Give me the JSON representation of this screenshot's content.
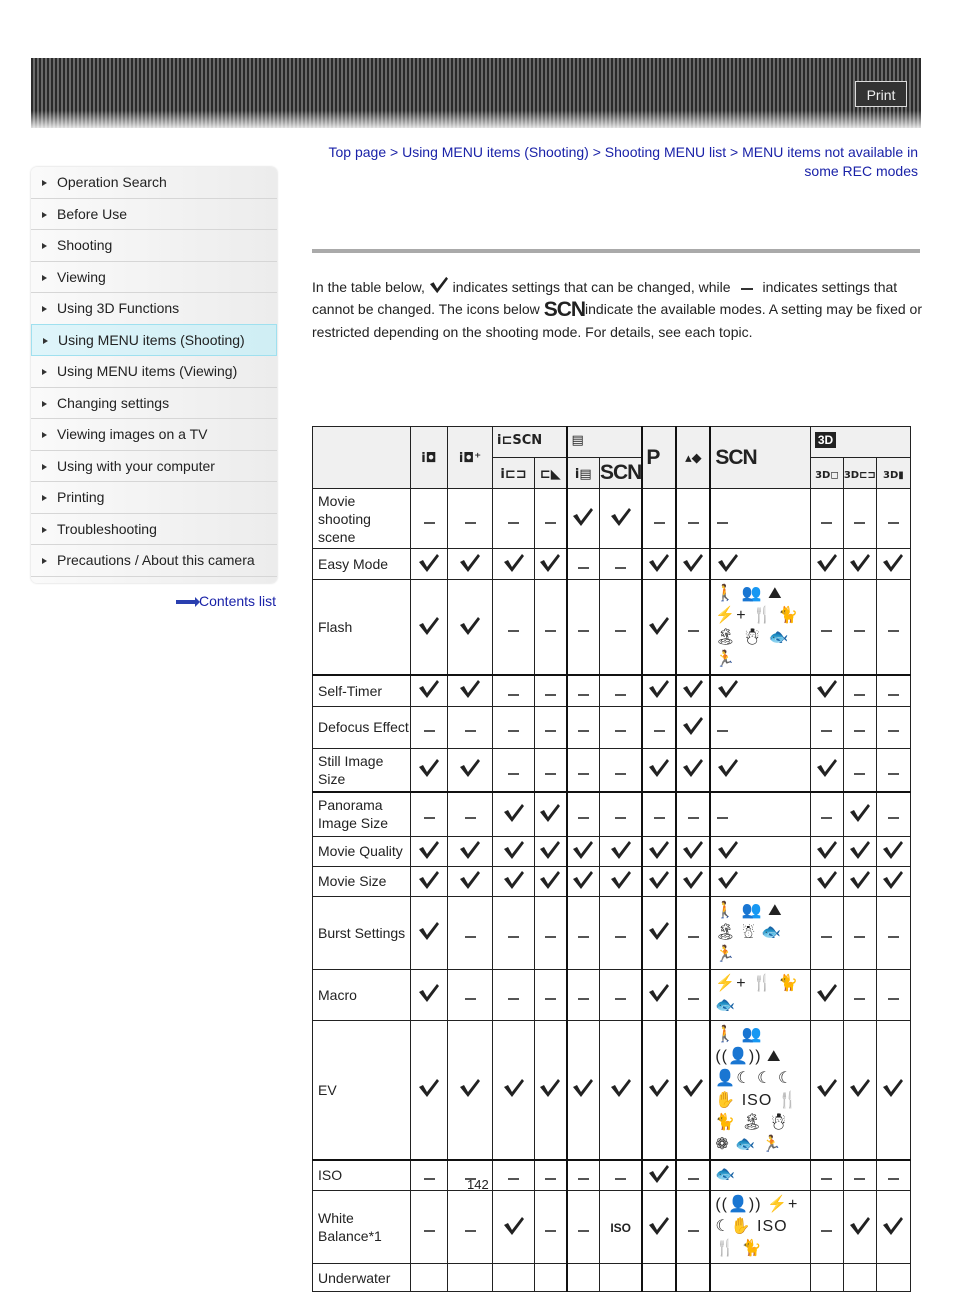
{
  "header": {
    "print_label": "Print"
  },
  "sidebar": {
    "items": [
      {
        "label": "Operation Search",
        "active": false
      },
      {
        "label": "Before Use",
        "active": false
      },
      {
        "label": "Shooting",
        "active": false
      },
      {
        "label": "Viewing",
        "active": false
      },
      {
        "label": "Using 3D Functions",
        "active": false
      },
      {
        "label": "Using MENU items (Shooting)",
        "active": true
      },
      {
        "label": "Using MENU items (Viewing)",
        "active": false
      },
      {
        "label": "Changing settings",
        "active": false
      },
      {
        "label": "Viewing images on a TV",
        "active": false
      },
      {
        "label": "Using with your computer",
        "active": false
      },
      {
        "label": "Printing",
        "active": false
      },
      {
        "label": "Troubleshooting",
        "active": false
      },
      {
        "label": "Precautions / About this camera",
        "active": false
      }
    ],
    "contents_link": "Contents list"
  },
  "breadcrumb": {
    "items": [
      "Top page",
      "Using MENU items (Shooting)",
      "Shooting MENU list",
      "MENU items not available in some REC modes"
    ],
    "separator": " > "
  },
  "intro": {
    "part1": "In the table below,",
    "part2": "indicates settings that can be changed, while",
    "part3": "indicates settings that cannot be changed. The icons below",
    "scn": "SCN",
    "part4": "indicate the available modes. A setting may be fixed or restricted depending on the shooting mode. For details, see each topic."
  },
  "table": {
    "header_top": [
      {
        "id": "iauto",
        "label": "i◘",
        "icon": "intelligent-auto-icon"
      },
      {
        "id": "superior",
        "label": "i◘⁺",
        "icon": "superior-auto-icon"
      },
      {
        "id": "sweep_group",
        "label": "i⊏SCN",
        "icon": "sweep-panorama-group-icon"
      },
      {
        "id": "movie_group",
        "label": "▤",
        "icon": "movie-mode-group-icon"
      },
      {
        "id": "p",
        "label": "P",
        "icon": "program-auto-icon"
      },
      {
        "id": "bgdefocus",
        "label": "▴◆",
        "icon": "background-defocus-icon"
      },
      {
        "id": "scn",
        "label": "SCN",
        "icon": "scene-selection-icon"
      },
      {
        "id": "3d_group",
        "label": "3D",
        "icon": "3d-group-icon"
      }
    ],
    "header_sub": [
      {
        "group": "sweep_group",
        "label": "i⊏⊐",
        "icon": "intelligent-sweep-panorama-icon"
      },
      {
        "group": "sweep_group",
        "label": "⊏◣",
        "icon": "sweep-panorama-scn-icon"
      },
      {
        "group": "movie_group",
        "label": "i▤",
        "icon": "intelligent-movie-icon"
      },
      {
        "group": "movie_group",
        "label": "SCN",
        "icon": "movie-scn-icon"
      },
      {
        "group": "3d_group",
        "label": "3D◻",
        "icon": "3d-still-icon"
      },
      {
        "group": "3d_group",
        "label": "3D⊏⊐",
        "icon": "3d-sweep-icon"
      },
      {
        "group": "3d_group",
        "label": "3D▮",
        "icon": "3d-multi-angle-icon"
      }
    ],
    "legend": {
      "check": "check",
      "dash": "dash"
    },
    "rows": [
      {
        "label": "Movie shooting scene",
        "cells": [
          "dash",
          "dash",
          "dash",
          "dash",
          "check",
          "check",
          "dash",
          "dash",
          "dash",
          "dash",
          "dash",
          "dash"
        ],
        "thick_top": false
      },
      {
        "label": "Easy Mode",
        "cells": [
          "check",
          "check",
          "check",
          "check",
          "dash",
          "dash",
          "check",
          "check",
          "check",
          "check",
          "check",
          "check"
        ],
        "thick_top": false
      },
      {
        "label": "Flash",
        "cells": [
          "check",
          "check",
          "dash",
          "dash",
          "dash",
          "dash",
          "check",
          "dash",
          {
            "icons": "🚶 👥 ⛰ ⚡+ 🍴 🐈 🏝 ☃ 🐟 🏃"
          },
          "dash",
          "dash",
          "dash"
        ],
        "thick_top": false
      },
      {
        "label": "Self-Timer",
        "cells": [
          "check",
          "check",
          "dash",
          "dash",
          "dash",
          "dash",
          "check",
          "check",
          "check",
          "check",
          "dash",
          "dash"
        ],
        "thick_top": true
      },
      {
        "label": "Defocus Effect",
        "cells": [
          "dash",
          "dash",
          "dash",
          "dash",
          "dash",
          "dash",
          "dash",
          "check",
          "dash",
          "dash",
          "dash",
          "dash"
        ],
        "thick_top": false
      },
      {
        "label": "Still Image Size",
        "cells": [
          "check",
          "check",
          "dash",
          "dash",
          "dash",
          "dash",
          "check",
          "check",
          "check",
          "check",
          "dash",
          "dash"
        ],
        "thick_top": false
      },
      {
        "label": "Panorama Image Size",
        "cells": [
          "dash",
          "dash",
          "check",
          "check",
          "dash",
          "dash",
          "dash",
          "dash",
          "dash",
          "dash",
          "check",
          "dash"
        ],
        "thick_top": true
      },
      {
        "label": "Movie Quality",
        "cells": [
          "check",
          "check",
          "check",
          "check",
          "check",
          "check",
          "check",
          "check",
          "check",
          "check",
          "check",
          "check"
        ],
        "thick_top": false
      },
      {
        "label": "Movie Size",
        "cells": [
          "check",
          "check",
          "check",
          "check",
          "check",
          "check",
          "check",
          "check",
          "check",
          "check",
          "check",
          "check"
        ],
        "thick_top": false
      },
      {
        "label": "Burst Settings",
        "cells": [
          "check",
          "dash",
          "dash",
          "dash",
          "dash",
          "dash",
          "check",
          "dash",
          {
            "icons": "🚶 👥 ⛰ 🏝 ☃ 🐟 🏃"
          },
          "dash",
          "dash",
          "dash"
        ],
        "thick_top": false
      },
      {
        "label": "Macro",
        "cells": [
          "check",
          "dash",
          "dash",
          "dash",
          "dash",
          "dash",
          "check",
          "dash",
          {
            "icons": "⚡+ 🍴 🐈 🐟"
          },
          "check",
          "dash",
          "dash"
        ],
        "thick_top": false
      },
      {
        "label": "EV",
        "cells": [
          "check",
          "check",
          "check",
          "check",
          "check",
          "check",
          "check",
          "check",
          {
            "icons": "🚶 👥 ((👤)) ⛰ 👤☾ ☾ ☾✋ ISO 🍴 🐈 🏝 ☃ ❁ 🐟 🏃"
          },
          "check",
          "check",
          "check"
        ],
        "thick_top": false
      },
      {
        "label": "ISO",
        "cells": [
          "dash",
          "dash",
          "dash",
          "dash",
          "dash",
          "dash",
          "check",
          "dash",
          {
            "icons": "🐟"
          },
          "dash",
          "dash",
          "dash"
        ],
        "thick_top": true
      },
      {
        "label": "White Balance*1",
        "cells": [
          "dash",
          "dash",
          "check",
          "dash",
          "dash",
          {
            "icons": "ISO"
          },
          "check",
          "dash",
          {
            "icons": "((👤)) ⚡+ ☾✋ ISO 🍴 🐈"
          },
          "dash",
          "check",
          "check"
        ],
        "thick_top": false
      },
      {
        "label": "Underwater",
        "cells": [
          "",
          "",
          "",
          "",
          "",
          "",
          "",
          "",
          "",
          "",
          "",
          ""
        ],
        "thick_top": false
      }
    ]
  },
  "footer": {
    "page_number": "142"
  }
}
